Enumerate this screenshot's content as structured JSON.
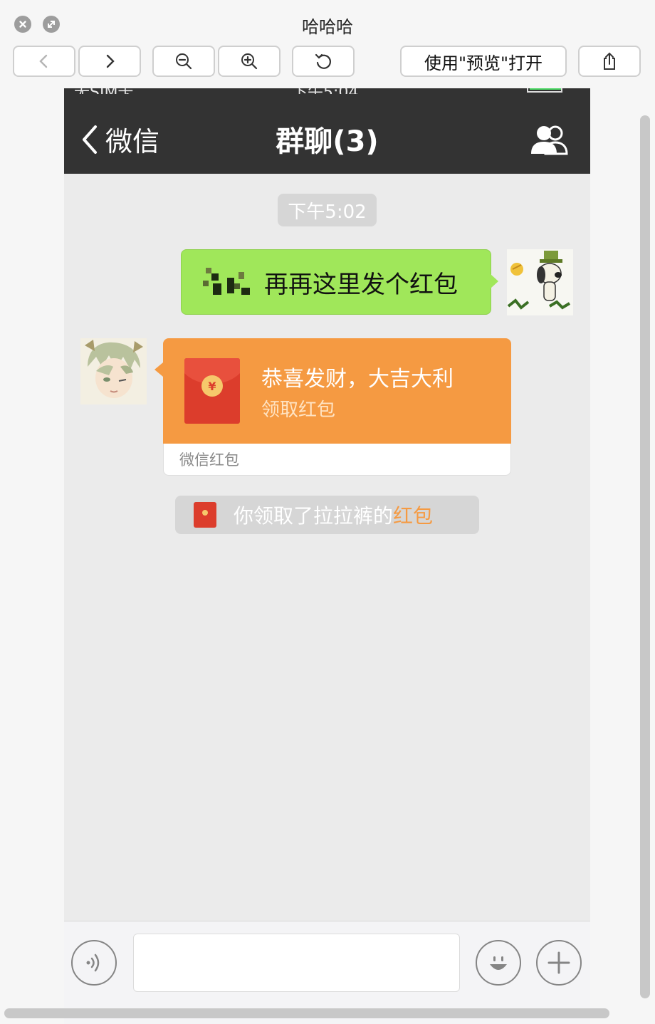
{
  "window": {
    "title": "哈哈哈",
    "open_with_label": "使用\"预览\"打开"
  },
  "phone": {
    "header": {
      "back_label": "微信",
      "chat_title": "群聊(3)"
    },
    "messages": {
      "timestamp": "下午5:02",
      "outgoing_text": "再再这里发个红包",
      "red_packet": {
        "greeting": "恭喜发财，大吉大利",
        "action": "领取红包",
        "footer": "微信红包",
        "coin_symbol": "¥"
      },
      "system_notice": {
        "prefix": "你领取了拉拉裤的",
        "highlight": "红包"
      }
    },
    "input": {
      "value": "",
      "placeholder": ""
    }
  },
  "colors": {
    "header_bg": "#333333",
    "chat_bg": "#ebebeb",
    "outgoing_bubble": "#a0e75a",
    "red_packet_orange": "#f59a42",
    "envelope_red": "#dc3d2c"
  },
  "icons": [
    "close-icon",
    "fullscreen-icon",
    "chevron-left-icon",
    "chevron-right-icon",
    "zoom-out-icon",
    "zoom-in-icon",
    "rotate-icon",
    "share-icon",
    "back-chevron-icon",
    "group-members-icon",
    "voice-icon",
    "emoji-icon",
    "plus-icon"
  ]
}
